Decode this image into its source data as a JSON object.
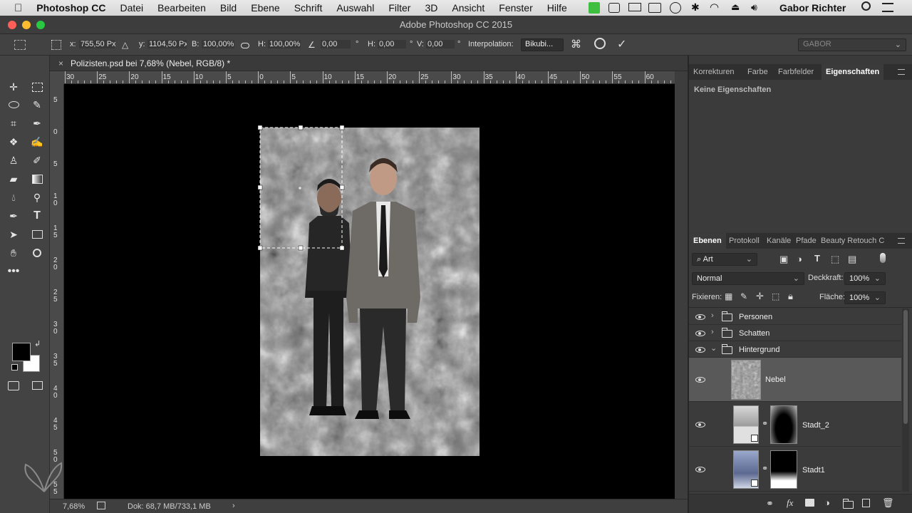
{
  "menubar": {
    "apple_icon": "apple-icon",
    "app_name": "Photoshop CC",
    "items": [
      "Datei",
      "Bearbeiten",
      "Bild",
      "Ebene",
      "Schrift",
      "Auswahl",
      "Filter",
      "3D",
      "Ansicht",
      "Fenster",
      "Hilfe"
    ],
    "user": "Gabor Richter"
  },
  "window": {
    "title": "Adobe Photoshop CC 2015"
  },
  "options": {
    "x_label": "x:",
    "x_value": "755,50 Px",
    "y_label": "y:",
    "y_value": "1104,50 Px",
    "w_label": "B:",
    "w_value": "100,00%",
    "h_label": "H:",
    "h_value": "100,00%",
    "angle_value": "0,00",
    "deg1": "°",
    "hskew_label": "H:",
    "hskew_value": "0,00",
    "deg2": "°",
    "vskew_label": "V:",
    "vskew_value": "0,00",
    "deg3": "°",
    "interp_label": "Interpolation:",
    "interp_value": "Bikubi...",
    "workspace": "GABOR"
  },
  "document": {
    "tab_title": "Polizisten.psd bei 7,68% (Nebel, RGB/8) *",
    "zoom": "7,68%",
    "doc_size": "Dok: 68,7 MB/733,1 MB",
    "arrow": "›"
  },
  "rulers": {
    "h_labels": [
      "30",
      "25",
      "20",
      "15",
      "10",
      "5",
      "0",
      "5",
      "10",
      "15",
      "20",
      "25",
      "30",
      "35",
      "40",
      "45",
      "50",
      "55",
      "60"
    ],
    "v_labels": [
      "5",
      "0",
      "5",
      "1\n0",
      "1\n5",
      "2\n0",
      "2\n5",
      "3\n0",
      "3\n5",
      "4\n0",
      "4\n5",
      "5\n0",
      "5\n5"
    ]
  },
  "top_panel": {
    "tabs": [
      "Korrekturen",
      "Farbe",
      "Farbfelder",
      "Eigenschaften"
    ],
    "active_tab": "Eigenschaften",
    "empty_message": "Keine Eigenschaften"
  },
  "layers_panel": {
    "tabs": [
      "Ebenen",
      "Protokoll",
      "Kanäle",
      "Pfade",
      "Beauty Retouch C"
    ],
    "filter_label": "Art",
    "blend_mode": "Normal",
    "opacity_label": "Deckkraft:",
    "opacity_value": "100%",
    "lock_label": "Fixieren:",
    "fill_label": "Fläche:",
    "fill_value": "100%",
    "layers": [
      {
        "name": "Personen",
        "type": "group",
        "expanded": false
      },
      {
        "name": "Schatten",
        "type": "group",
        "expanded": false
      },
      {
        "name": "Hintergrund",
        "type": "group",
        "expanded": true
      },
      {
        "name": "Nebel",
        "type": "layer",
        "selected": true
      },
      {
        "name": "Stadt_2",
        "type": "smart-object-masked"
      },
      {
        "name": "Stadt1",
        "type": "smart-object-masked"
      }
    ],
    "bottom_icons": [
      "link-icon",
      "fx-icon",
      "mask-icon",
      "adjustment-icon",
      "new-group-icon",
      "new-layer-icon",
      "trash-icon"
    ]
  },
  "colors": {
    "foreground": "#000000",
    "background": "#ffffff",
    "selected_layer": "#595959",
    "panel_bg": "#3b3b3b"
  }
}
